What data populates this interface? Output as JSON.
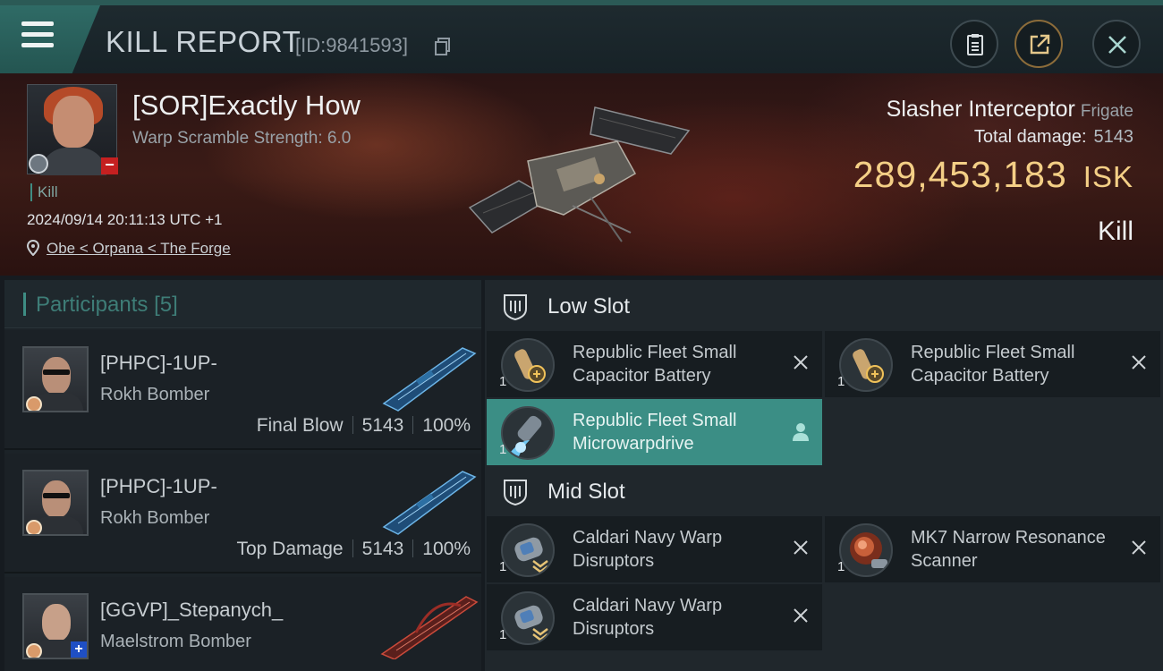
{
  "header": {
    "title": "KILL REPORT",
    "report_id": "[ID:9841593]"
  },
  "victim": {
    "name": "[SOR]Exactly How",
    "scramble": "Warp Scramble Strength: 6.0",
    "tag": "Kill",
    "timestamp": "2024/09/14 20:11:13 UTC +1",
    "location": "Obe < Orpana < The Forge"
  },
  "ship": {
    "name": "Slasher Interceptor",
    "class": "Frigate",
    "damage_label": "Total damage:",
    "damage_value": "5143",
    "isk_value": "289,453,183",
    "isk_unit": "ISK",
    "result": "Kill"
  },
  "participants": {
    "title": "Participants",
    "count": "[5]",
    "rows": [
      {
        "name": "[PHPC]-1UP-",
        "ship": "Rokh Bomber",
        "role": "Final Blow",
        "damage": "5143",
        "percent": "100%"
      },
      {
        "name": "[PHPC]-1UP-",
        "ship": "Rokh Bomber",
        "role": "Top Damage",
        "damage": "5143",
        "percent": "100%"
      },
      {
        "name": "[GGVP]_Stepanych_",
        "ship": "Maelstrom Bomber",
        "role": "",
        "damage": "",
        "percent": ""
      }
    ]
  },
  "fitting": {
    "low_slot": {
      "title": "Low Slot",
      "modules": [
        {
          "qty": "1",
          "name": "Republic Fleet Small Capacitor Battery"
        },
        {
          "qty": "1",
          "name": "Republic Fleet Small Capacitor Battery"
        },
        {
          "qty": "1",
          "name": "Republic Fleet Small Microwarpdrive"
        }
      ]
    },
    "mid_slot": {
      "title": "Mid Slot",
      "modules": [
        {
          "qty": "1",
          "name": "Caldari Navy Warp Disruptors"
        },
        {
          "qty": "1",
          "name": "MK7 Narrow Resonance Scanner"
        },
        {
          "qty": "1",
          "name": "Caldari Navy Warp Disruptors"
        }
      ]
    }
  },
  "colors": {
    "accent": "#3e8d84",
    "isk_gold": "#f4cf86",
    "active_module": "#3b8e85"
  }
}
